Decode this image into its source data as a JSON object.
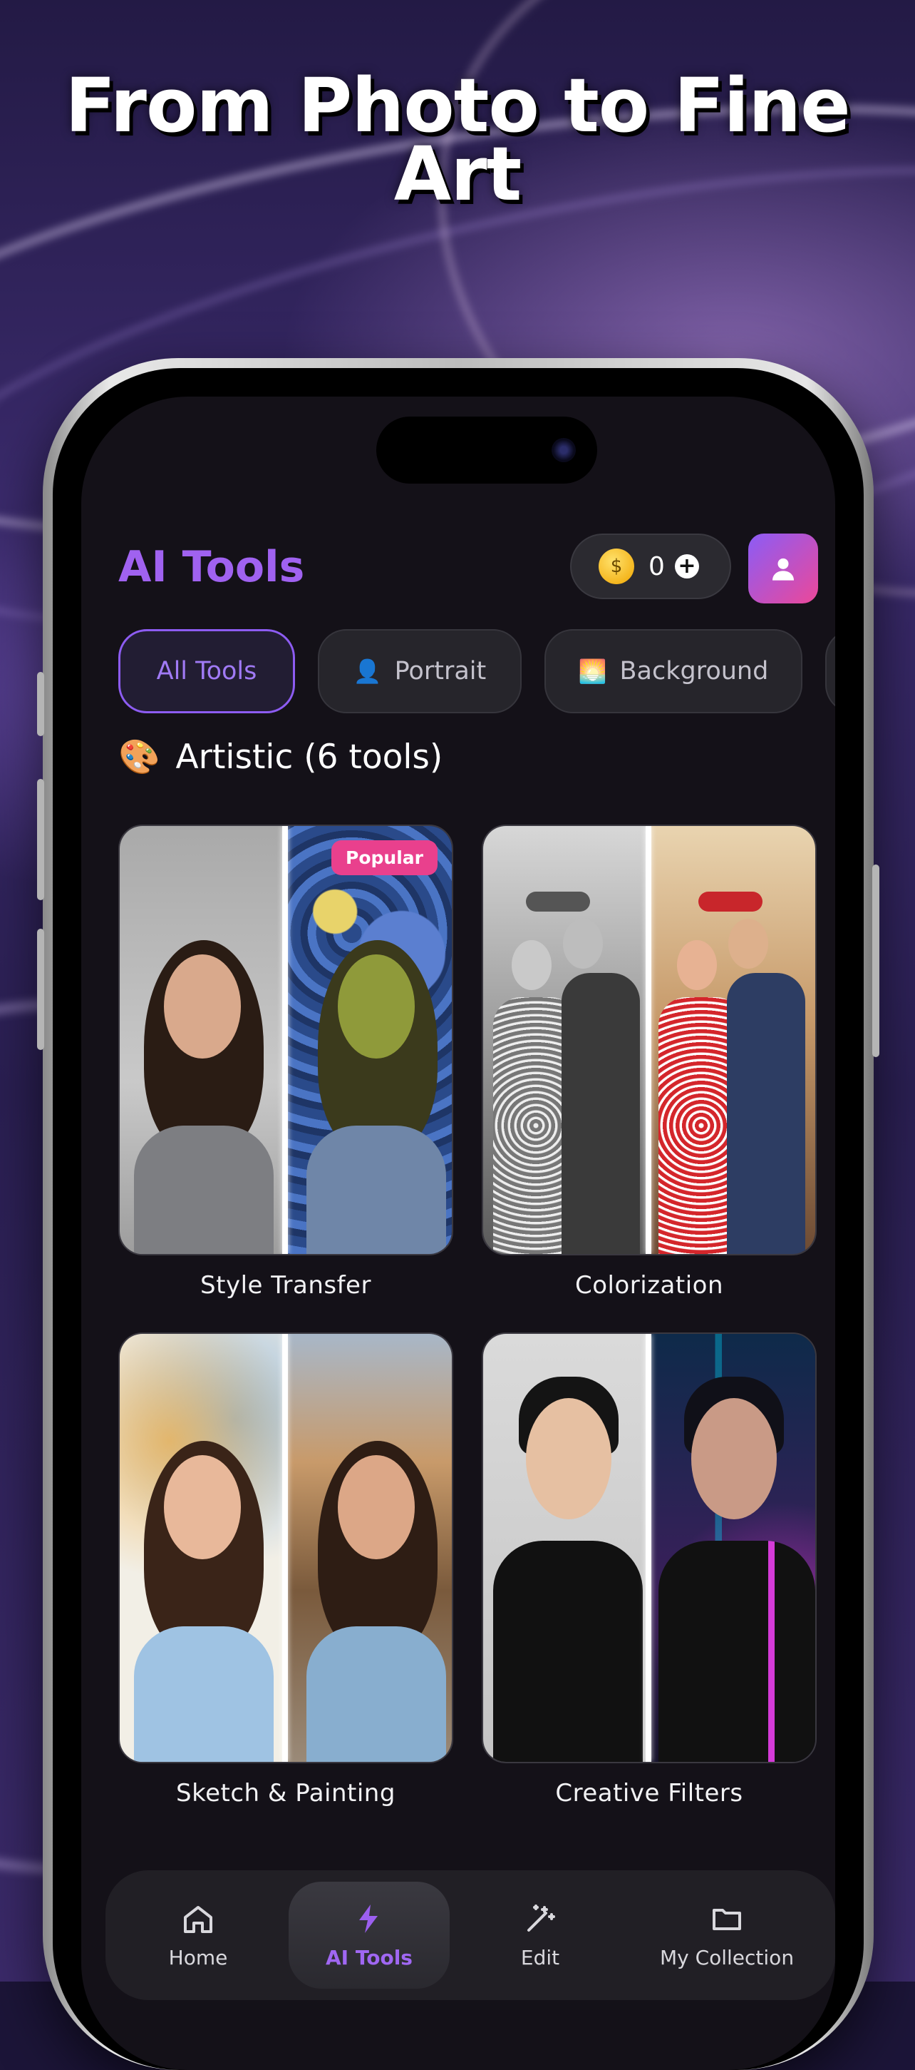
{
  "hero": {
    "line1": "From Photo to Fine",
    "line2": "Art"
  },
  "header": {
    "title": "AI Tools",
    "coins": "0",
    "coin_icon": "money-bag-icon",
    "profile_icon": "user-icon"
  },
  "chips": [
    {
      "label": "All Tools",
      "icon": "",
      "active": true
    },
    {
      "label": "Portrait",
      "icon": "👤",
      "active": false
    },
    {
      "label": "Background",
      "icon": "🌅",
      "active": false
    }
  ],
  "section": {
    "icon": "🎨",
    "title": "Artistic (6 tools)"
  },
  "tools": [
    {
      "name": "Style Transfer",
      "badge": "Popular"
    },
    {
      "name": "Colorization"
    },
    {
      "name": "Sketch & Painting"
    },
    {
      "name": "Creative Filters"
    }
  ],
  "nav": [
    {
      "label": "Home",
      "icon": "home-icon",
      "active": false
    },
    {
      "label": "AI Tools",
      "icon": "bolt-icon",
      "active": true
    },
    {
      "label": "Edit",
      "icon": "magic-wand-icon",
      "active": false
    },
    {
      "label": "My Collection",
      "icon": "folder-icon",
      "active": false
    }
  ],
  "colors": {
    "accent": "#a062f0",
    "badge": "#e9408d",
    "screen_bg": "#141118"
  }
}
